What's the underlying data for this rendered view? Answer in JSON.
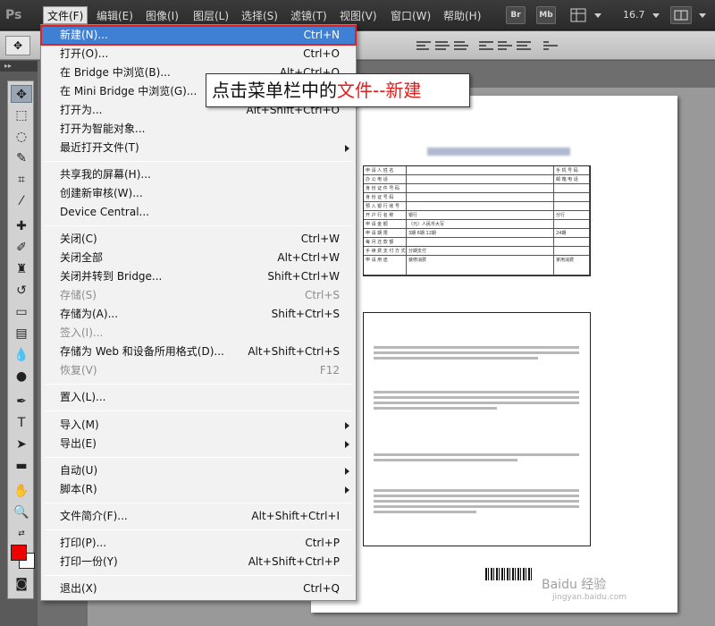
{
  "app": {
    "logo": "Ps"
  },
  "menubar": {
    "items": [
      {
        "label": "文件(F)"
      },
      {
        "label": "编辑(E)"
      },
      {
        "label": "图像(I)"
      },
      {
        "label": "图层(L)"
      },
      {
        "label": "选择(S)"
      },
      {
        "label": "滤镜(T)"
      },
      {
        "label": "视图(V)"
      },
      {
        "label": "窗口(W)"
      },
      {
        "label": "帮助(H)"
      }
    ],
    "br_label": "Br",
    "mb_label": "Mb",
    "zoom": "16.7"
  },
  "file_menu": {
    "items": [
      {
        "label": "新建(N)...",
        "shortcut": "Ctrl+N"
      },
      {
        "label": "打开(O)...",
        "shortcut": "Ctrl+O"
      },
      {
        "label": "在 Bridge 中浏览(B)...",
        "shortcut": "Alt+Ctrl+O"
      },
      {
        "label": "在 Mini Bridge 中浏览(G)...",
        "shortcut": ""
      },
      {
        "label": "打开为...",
        "shortcut": "Alt+Shift+Ctrl+O"
      },
      {
        "label": "打开为智能对象...",
        "shortcut": ""
      },
      {
        "label": "最近打开文件(T)",
        "shortcut": ""
      },
      {
        "label": "共享我的屏幕(H)...",
        "shortcut": ""
      },
      {
        "label": "创建新审核(W)...",
        "shortcut": ""
      },
      {
        "label": "Device Central...",
        "shortcut": ""
      },
      {
        "label": "关闭(C)",
        "shortcut": "Ctrl+W"
      },
      {
        "label": "关闭全部",
        "shortcut": "Alt+Ctrl+W"
      },
      {
        "label": "关闭并转到 Bridge...",
        "shortcut": "Shift+Ctrl+W"
      },
      {
        "label": "存储(S)",
        "shortcut": "Ctrl+S"
      },
      {
        "label": "存储为(A)...",
        "shortcut": "Shift+Ctrl+S"
      },
      {
        "label": "签入(I)...",
        "shortcut": ""
      },
      {
        "label": "存储为 Web 和设备所用格式(D)...",
        "shortcut": "Alt+Shift+Ctrl+S"
      },
      {
        "label": "恢复(V)",
        "shortcut": "F12"
      },
      {
        "label": "置入(L)...",
        "shortcut": ""
      },
      {
        "label": "导入(M)",
        "shortcut": ""
      },
      {
        "label": "导出(E)",
        "shortcut": ""
      },
      {
        "label": "自动(U)",
        "shortcut": ""
      },
      {
        "label": "脚本(R)",
        "shortcut": ""
      },
      {
        "label": "文件简介(F)...",
        "shortcut": "Alt+Shift+Ctrl+I"
      },
      {
        "label": "打印(P)...",
        "shortcut": "Ctrl+P"
      },
      {
        "label": "打印一份(Y)",
        "shortcut": "Alt+Shift+Ctrl+P"
      },
      {
        "label": "退出(X)",
        "shortcut": "Ctrl+Q"
      }
    ]
  },
  "annotation": {
    "prefix": "点击菜单栏中的",
    "highlight": "文件--新建"
  },
  "document": {
    "form_rows": [
      {
        "c1": "申 请 人 姓 名",
        "c2": "",
        "c3": "手 机 号 码"
      },
      {
        "c1": "办 公 电 话",
        "c2": "",
        "c3": "邮 箱 电 话"
      },
      {
        "c1": "身 份 证 件 号 码",
        "c2": "",
        "c3": ""
      },
      {
        "c1": "身 份 证 号 码",
        "c2": "",
        "c3": ""
      },
      {
        "c1": "预 入 银 行 账 号",
        "c2": "",
        "c3": ""
      },
      {
        "c1": "开 户 行 名 称",
        "c2": "银行",
        "c3": "分行"
      },
      {
        "c1": "申 请 金 额",
        "c2": "（元）人民币大写",
        "c3": ""
      },
      {
        "c1": "申 请 期 限",
        "c2": "3期 6期 12期",
        "c3": "24期"
      },
      {
        "c1": "每 月 还 款 额",
        "c2": "",
        "c3": ""
      },
      {
        "c1": "手 续 费 支 付 方 式",
        "c2": "分期支付",
        "c3": ""
      },
      {
        "c1": "申 请 用 途",
        "c2": "装修消费",
        "c3": "家用消费"
      }
    ],
    "watermark": "Baidu 经验",
    "watermark_sub": "jingyan.baidu.com"
  },
  "colors": {
    "highlight_bg": "#3f7fd4",
    "highlight_border": "#e02222",
    "annotation_red": "#e31c1c",
    "foreground_color": "#ee0000",
    "background_color": "#ffffff"
  }
}
